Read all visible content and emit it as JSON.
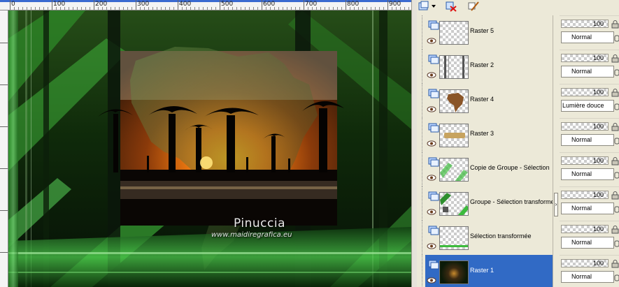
{
  "ruler": {
    "top_labels": [
      "0",
      "100",
      "200",
      "300",
      "400",
      "500",
      "600",
      "700",
      "800",
      "900"
    ],
    "left_labels": [
      "100",
      "200",
      "300",
      "400",
      "500",
      "600"
    ]
  },
  "canvas": {
    "artist_signature": "Pinuccia",
    "website": "www.maidiregrafica.eu"
  },
  "toolbar": {
    "icons": [
      "new-layer-icon",
      "dropdown-arrow-icon",
      "delete-layer-icon",
      "edit-mask-icon"
    ]
  },
  "layers": [
    {
      "name": "Raster 5",
      "opacity": "100",
      "blend": "Normal",
      "thumb": "blank"
    },
    {
      "name": "Raster 2",
      "opacity": "100",
      "blend": "Normal",
      "thumb": "stripes"
    },
    {
      "name": "Raster 4",
      "opacity": "100",
      "blend": "Lumière douce",
      "thumb": "africa"
    },
    {
      "name": "Raster 3",
      "opacity": "100",
      "blend": "Normal",
      "thumb": "strip"
    },
    {
      "name": "Copie de Groupe - Sélection",
      "opacity": "100",
      "blend": "Normal",
      "thumb": "green-diag"
    },
    {
      "name": "Groupe - Sélection transforme",
      "opacity": "100",
      "blend": "Normal",
      "thumb": "green-diag2"
    },
    {
      "name": "Sélection transformée",
      "opacity": "100",
      "blend": "Normal",
      "thumb": "green-bottom"
    },
    {
      "name": "Raster 1",
      "opacity": "100",
      "blend": "Normal",
      "thumb": "dark",
      "selected": true
    }
  ],
  "colors": {
    "selection": "#316ac5",
    "panel": "#ece9d8",
    "accent_green": "#3dbb3d"
  }
}
